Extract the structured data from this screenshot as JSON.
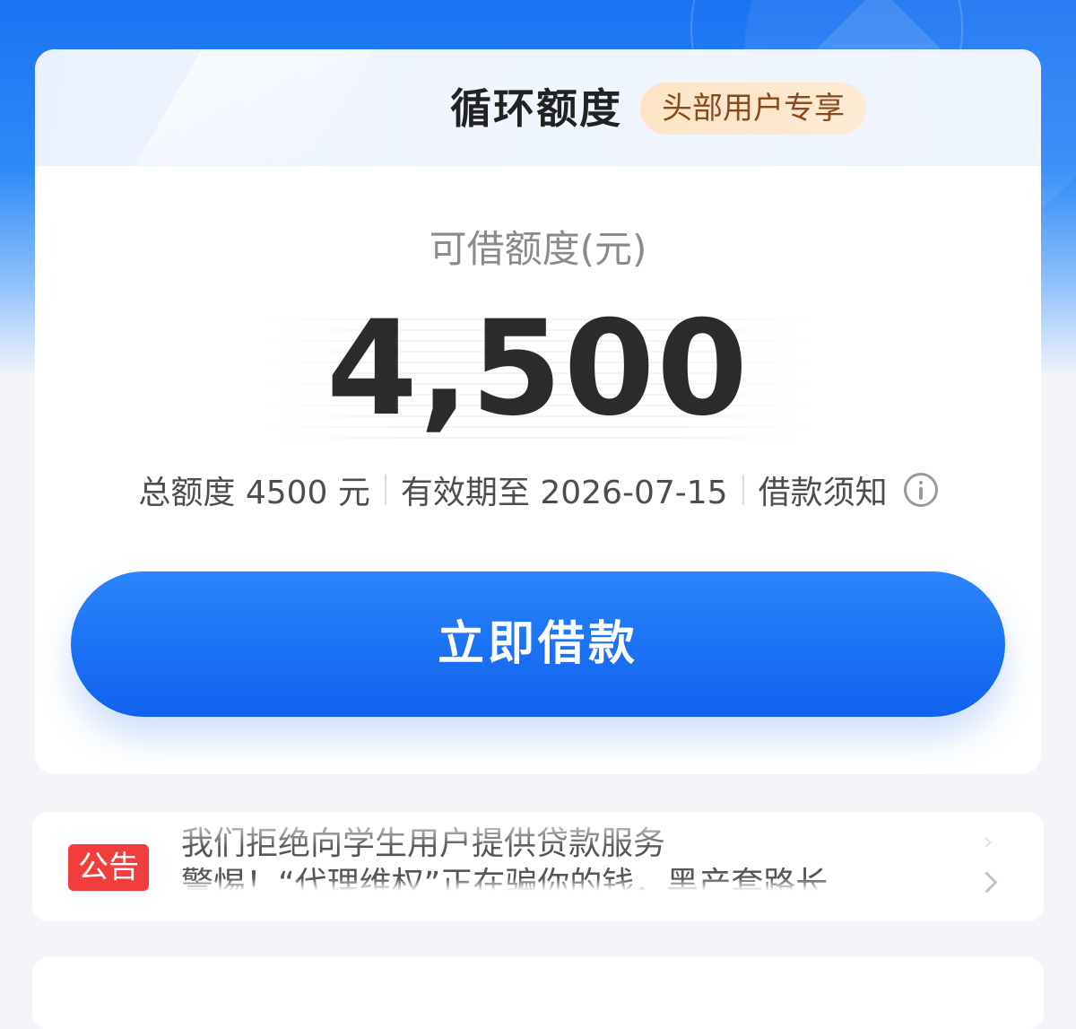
{
  "card": {
    "title": "循环额度",
    "tag": "头部用户专享",
    "available_label": "可借额度(元)",
    "available_amount": "4,500",
    "info": {
      "total_limit": "总额度 4500 元",
      "valid_until": "有效期至 2026-07-15",
      "loan_notice": "借款须知"
    },
    "borrow_button": "立即借款"
  },
  "notice": {
    "badge": "公告",
    "lines": [
      "我们拒绝向学生用户提供贷款服务",
      "警惕！“代理维权”正在骗你的钱，黑产套路长"
    ]
  },
  "colors": {
    "primary": "#1a73f2",
    "button": "#0f62ef",
    "tag_bg": "#fde4c6",
    "badge": "#f23d3d"
  },
  "icons": [
    "info-icon",
    "chevron-right-icon"
  ]
}
